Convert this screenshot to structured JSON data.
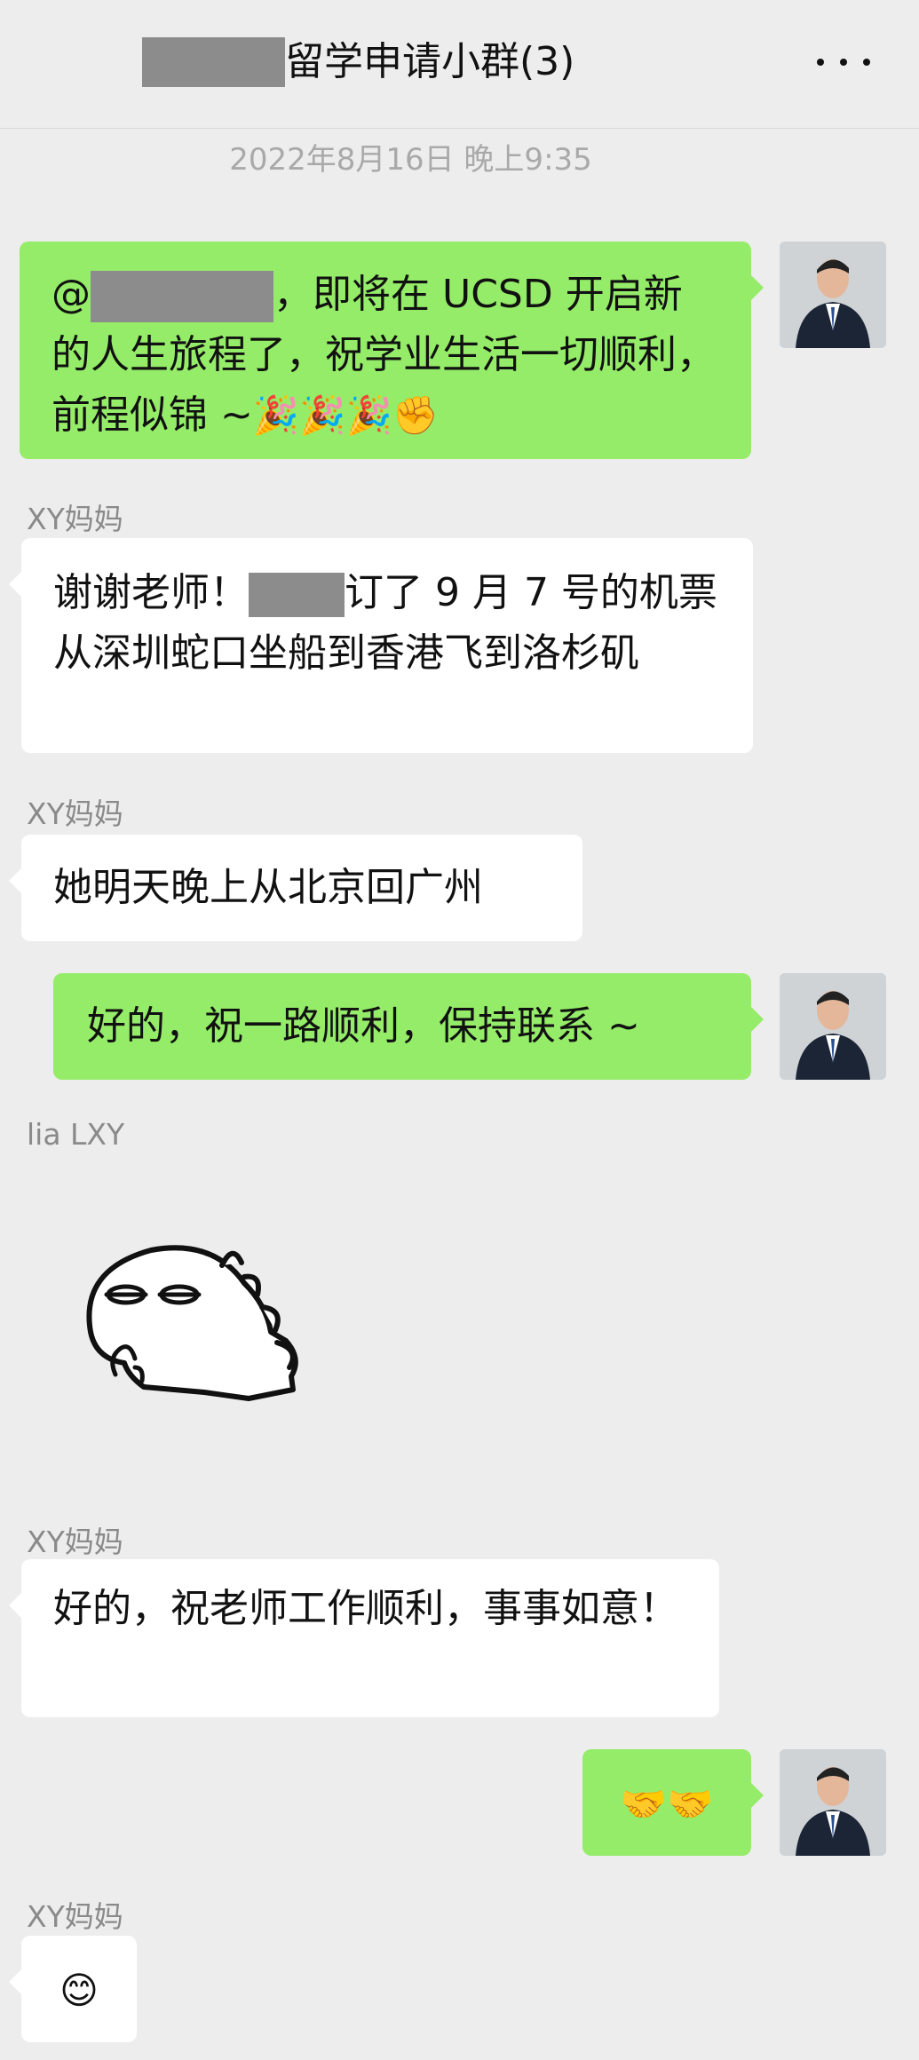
{
  "header": {
    "title": "留学申请小群(3)",
    "more_icon": "more-dots-icon"
  },
  "timestamp": "2022年8月16日 晚上9:35",
  "messages": [
    {
      "from": "self",
      "prefix": "@",
      "text": "，即将在 UCSD 开启新的人生旅程了，祝学业生活一切顺利，前程似锦 ~",
      "emoji": "🎉🎉🎉✊"
    },
    {
      "from": "other",
      "sender": "XY妈妈",
      "text_a": "谢谢老师！",
      "text_b": "订了 9 月 7 号的机票从深圳蛇口坐船到香港飞到洛杉矶"
    },
    {
      "from": "other",
      "sender": "XY妈妈",
      "text": "她明天晚上从北京回广州"
    },
    {
      "from": "self",
      "text": "好的，祝一路顺利，保持联系 ~"
    },
    {
      "from": "other",
      "sender": "lia LXY",
      "sticker": "dinosaur-sticker"
    },
    {
      "from": "other",
      "sender": "XY妈妈",
      "text": "好的，祝老师工作顺利，事事如意！"
    },
    {
      "from": "self",
      "emoji": "🤝🤝"
    },
    {
      "from": "other",
      "sender": "XY妈妈",
      "emoji": "😊"
    }
  ]
}
